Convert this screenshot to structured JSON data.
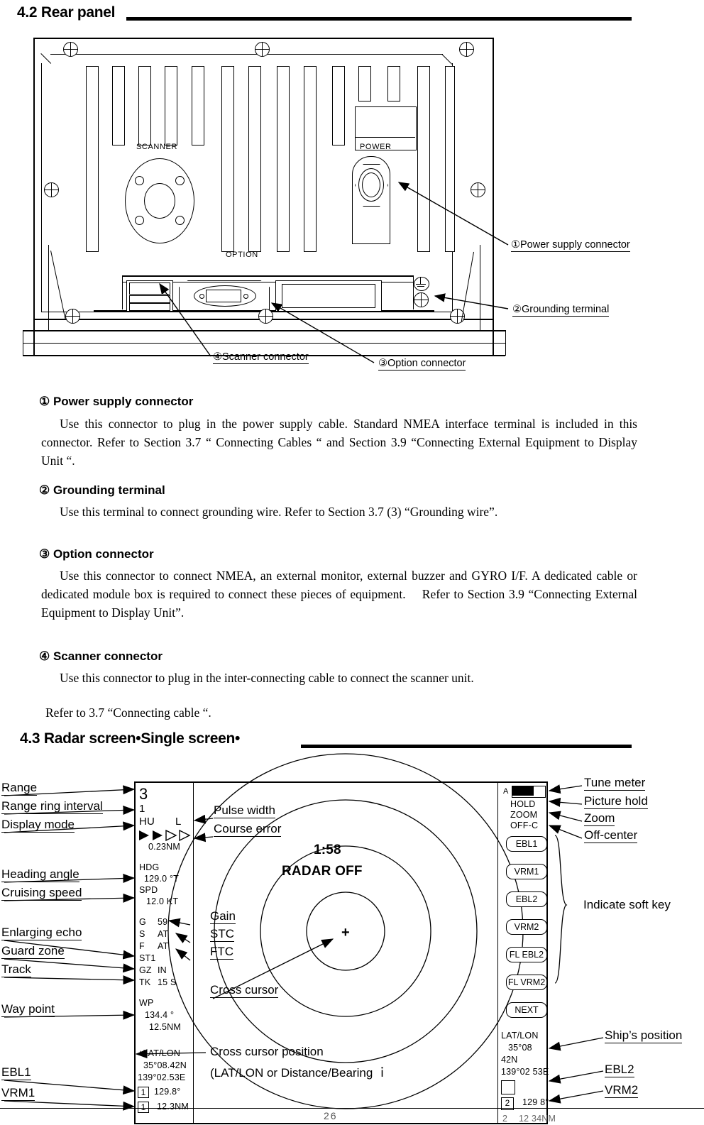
{
  "page": {
    "number": "26"
  },
  "section_42": {
    "heading": "4.2 Rear panel"
  },
  "rear_panel_diagram": {
    "port_labels": {
      "scanner": "SCANNER",
      "power": "POWER",
      "option": "OPTION"
    },
    "callouts": [
      {
        "id": "callout-power-supply",
        "text": "①Power supply connector"
      },
      {
        "id": "callout-grounding",
        "text": "②Grounding terminal"
      },
      {
        "id": "callout-option",
        "text": "③Option connector"
      },
      {
        "id": "callout-scanner",
        "text": "④Scanner connector"
      }
    ]
  },
  "descriptions": [
    {
      "marker_title": "① Power supply connector",
      "body": "Use this connector to plug in the power supply cable. Standard NMEA interface terminal is included in this connector. Refer to Section 3.7 “ Connecting Cables “ and Section 3.9 “Connecting External Equipment to Display Unit “."
    },
    {
      "marker_title": "② Grounding terminal",
      "body": "Use this terminal to connect grounding wire. Refer to Section 3.7 (3) “Grounding wire”."
    },
    {
      "marker_title": "③ Option connector",
      "body": "Use this connector to connect NMEA, an external monitor, external buzzer and GYRO I/F. A dedicated cable or dedicated module box is required to connect these pieces of equipment.  Refer to Section 3.9 “Connecting External Equipment to Display Unit”."
    },
    {
      "marker_title": "④ Scanner connector",
      "body": "Use this connector to plug in the inter-connecting cable to connect the scanner unit.",
      "body2": "Refer to 3.7 “Connecting cable “."
    }
  ],
  "section_43": {
    "heading": "4.3 Radar screen•Single screen•"
  },
  "radar_figure": {
    "left_labels": [
      {
        "id": "label-range",
        "text": "Range"
      },
      {
        "id": "label-range-ring-interval",
        "text": "Range ring interval"
      },
      {
        "id": "label-display-mode",
        "text": "Display mode"
      },
      {
        "id": "label-heading-angle",
        "text": "Heading angle"
      },
      {
        "id": "label-cruising-speed",
        "text": "Cruising speed"
      },
      {
        "id": "label-enlarging-echo",
        "text": "Enlarging echo"
      },
      {
        "id": "label-guard-zone",
        "text": "Guard zone"
      },
      {
        "id": "label-track",
        "text": "Track"
      },
      {
        "id": "label-way-point",
        "text": "Way point"
      },
      {
        "id": "label-ebl1",
        "text": "EBL1"
      },
      {
        "id": "label-vrm1",
        "text": "VRM1"
      }
    ],
    "inner_labels": [
      {
        "id": "label-pulse-width",
        "text": "Pulse width"
      },
      {
        "id": "label-course-error",
        "text": "Course error"
      },
      {
        "id": "label-gain",
        "text": "Gain"
      },
      {
        "id": "label-stc",
        "text": "STC"
      },
      {
        "id": "label-ftc",
        "text": "FTC"
      },
      {
        "id": "label-cross-cursor",
        "text": "Cross cursor"
      }
    ],
    "cursor_position_label_line1": "Cross cursor position",
    "cursor_position_label_line2": "(LAT/LON or Distance/Bearing ｉ",
    "right_labels": [
      {
        "id": "label-tune-meter",
        "text": "Tune meter"
      },
      {
        "id": "label-picture-hold",
        "text": "Picture hold"
      },
      {
        "id": "label-zoom",
        "text": "Zoom"
      },
      {
        "id": "label-off-center",
        "text": "Off-center"
      },
      {
        "id": "label-indicate-soft-key",
        "text": "Indicate soft key"
      },
      {
        "id": "label-ships-position",
        "text": "Ship’s position"
      },
      {
        "id": "label-ebl2",
        "text": "EBL2"
      },
      {
        "id": "label-vrm2",
        "text": "VRM2"
      }
    ],
    "screen": {
      "range": "3",
      "range_ring_interval": "1",
      "display_mode": "HU",
      "pulse_width_letter": "L",
      "course_error_value": "0.23",
      "course_error_unit": "NM",
      "hdg_label": "HDG",
      "hdg_value": "129.0 °T",
      "spd_label": "SPD",
      "spd_value": "12.0 KT",
      "gain_key": "G",
      "gain_value": "59",
      "stc_key": "S",
      "stc_value": "AT",
      "ftc_key": "F",
      "ftc_value": "AT",
      "st_value": "ST1",
      "gz_key": "GZ",
      "gz_value": "IN",
      "tk_key": "TK",
      "tk_value": "15 S",
      "wp_label": "WP",
      "wp_bearing": "134.4 °",
      "wp_distance": "12.5NM",
      "cursor_latlon_label": "+LAT/LON",
      "cursor_lat": "35°08.42N",
      "cursor_lon": "139°02.53E",
      "ebl1_box": "1",
      "ebl1_value": "129.8°",
      "vrm1_box": "1",
      "vrm1_value": "12.3NM",
      "timer": "1:58",
      "status": "RADAR OFF",
      "tune_meter_letter": "A",
      "hold": "HOLD",
      "zoom": "ZOOM",
      "off_center": "OFF-C",
      "soft_keys": [
        "EBL1",
        "VRM1",
        "EBL2",
        "VRM2",
        "FL EBL2",
        "FL VRM2",
        "NEXT"
      ],
      "ship_latlon_label": "LAT/LON",
      "ship_lat_line1": "35°08",
      "ship_lat_line2": "42N",
      "ship_lon": "139°02  53E",
      "ebl2_box": "2",
      "ebl2_value": "129  8°",
      "vrm2_box": "2",
      "vrm2_value": "12  34NM"
    }
  }
}
